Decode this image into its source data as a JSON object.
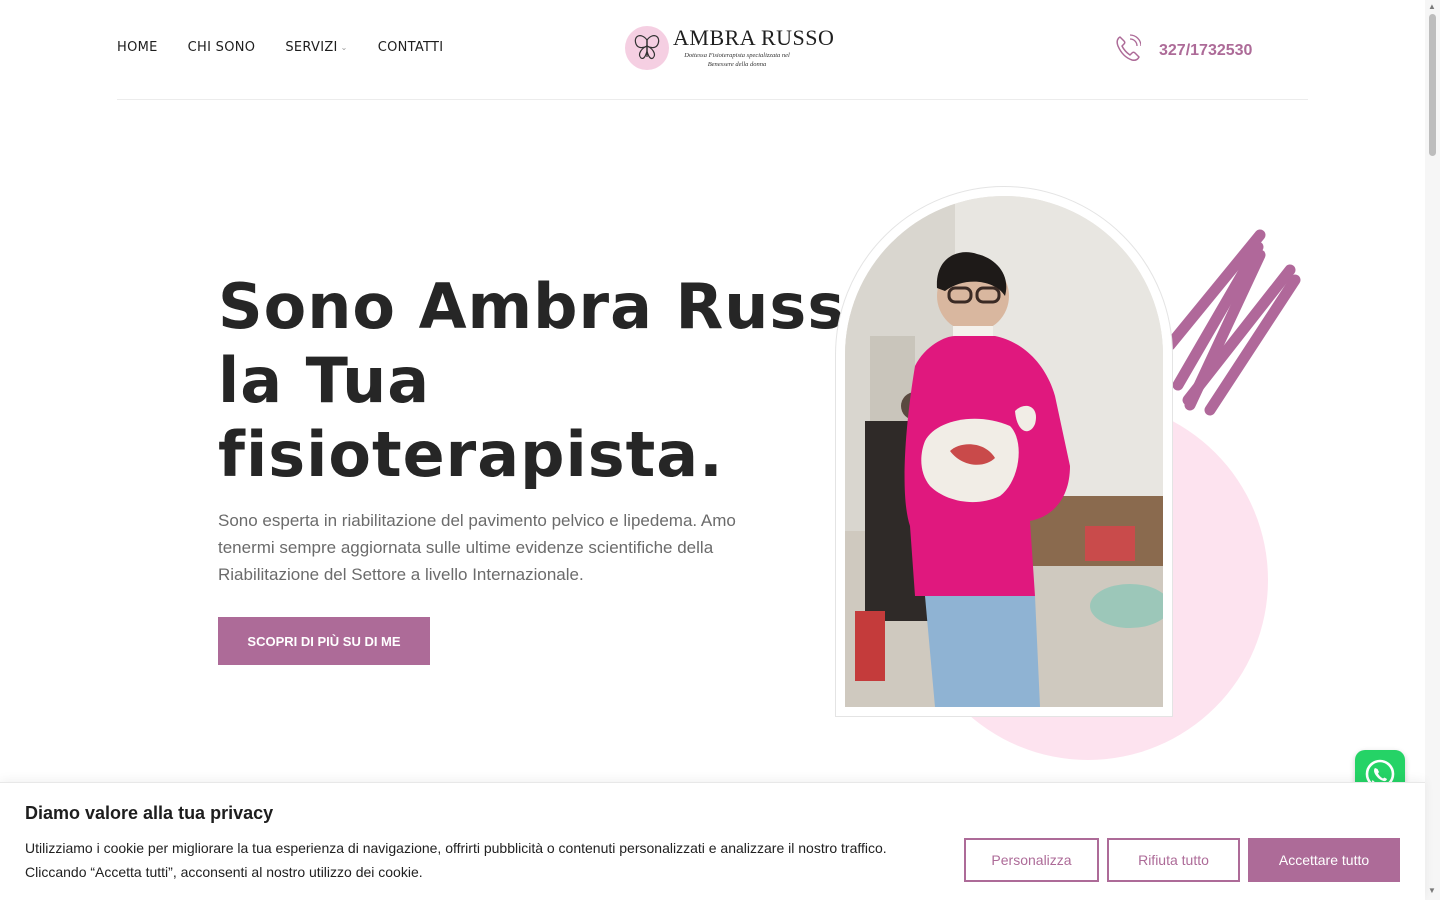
{
  "header": {
    "nav": [
      {
        "label": "HOME"
      },
      {
        "label": "CHI SONO"
      },
      {
        "label": "SERVIZI",
        "has_dropdown": true
      },
      {
        "label": "CONTATTI"
      }
    ],
    "logo": {
      "name": "AMBRA RUSSO",
      "tagline": "Dottessa Fisioterapista specializzata nel Benessere della donna"
    },
    "phone": {
      "number": "327/1732530",
      "icon": "phone-icon"
    }
  },
  "hero": {
    "title_lines": [
      "Sono Ambra Russo,",
      "la Tua",
      "fisioterapista."
    ],
    "description": "Sono esperta in riabilitazione del pavimento pelvico e lipedema. Amo tenermi sempre aggiornata sulle ultime evidenze scientifiche della Riabilitazione del Settore a livello Internazionale.",
    "cta_label": "SCOPRI DI PIÙ SU DI ME"
  },
  "cookie_banner": {
    "title": "Diamo valore alla tua privacy",
    "text": "Utilizziamo i cookie per migliorare la tua esperienza di navigazione, offrirti pubblicità o contenuti personalizzati e analizzare il nostro traffico. Cliccando “Accetta tutti”, acconsenti al nostro utilizzo dei cookie.",
    "buttons": {
      "customize": "Personalizza",
      "reject": "Rifiuta tutto",
      "accept": "Accettare tutto"
    }
  },
  "colors": {
    "accent": "#ad6b98",
    "pink_circle": "#fde3ef",
    "whatsapp": "#25d366",
    "text_dark": "#262626",
    "text_muted": "#6b6b6b"
  },
  "icons": [
    "phone-icon",
    "chevron-down-icon",
    "butterfly-logo-icon",
    "whatsapp-icon",
    "scroll-up-arrow-icon",
    "scroll-down-arrow-icon"
  ]
}
